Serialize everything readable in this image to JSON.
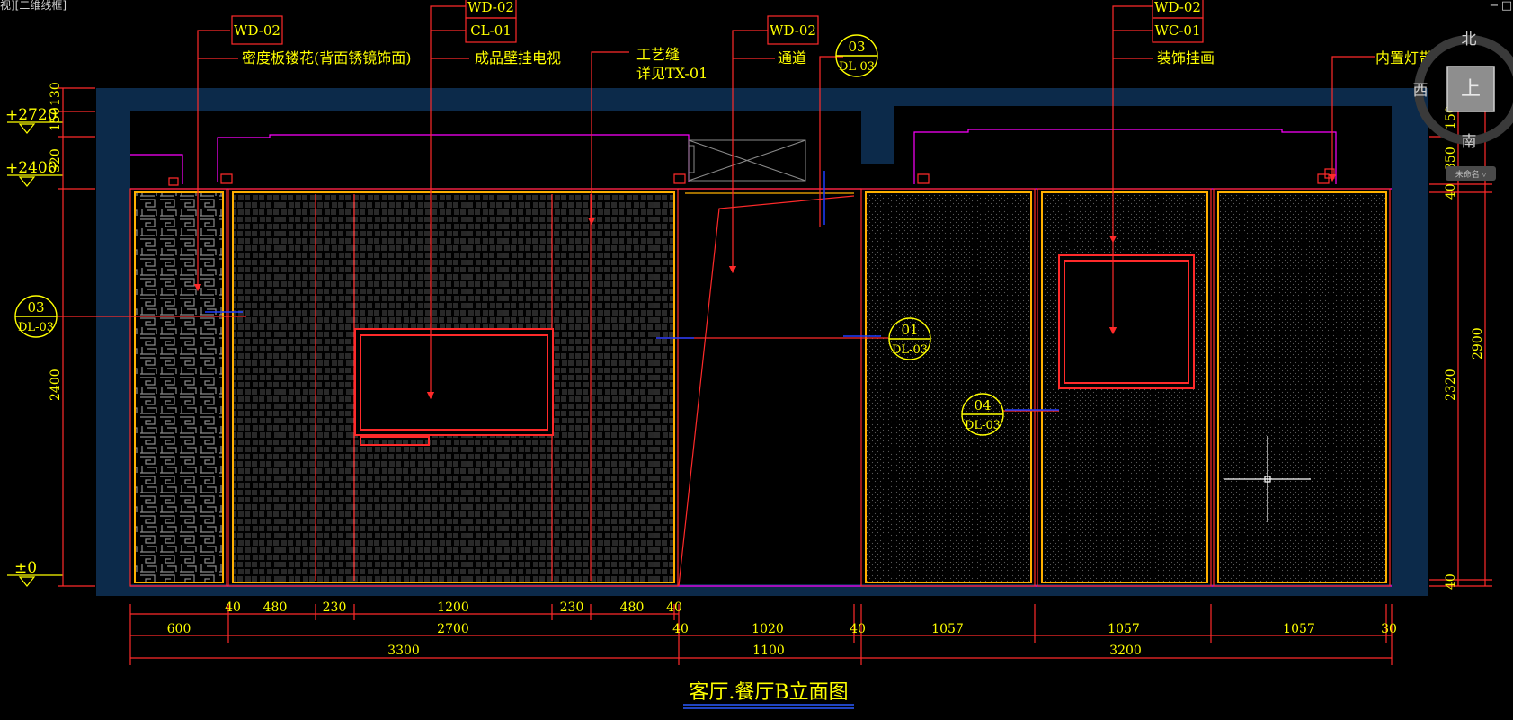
{
  "app": {
    "view_label": "视][二维线框]",
    "window_controls": [
      "−",
      "□"
    ]
  },
  "colors": {
    "background": "#000000",
    "structure": "#0c2a4a",
    "red": "#ff2a2a",
    "yellow": "#ffff00",
    "orange": "#ffb000",
    "magenta": "#ff00ff",
    "white": "#ffffff",
    "cyan": "#00c8c8",
    "blue": "#1e3cff",
    "gray": "#7a7a7a"
  },
  "drawing": {
    "title": "客厅.餐厅B立面图",
    "tags": {
      "t1": "WD-02",
      "t2a": "WD-02",
      "t2b": "CL-01",
      "t3": "WD-02",
      "t4a": "WD-02",
      "t4b": "WC-01"
    },
    "notes": {
      "n1": "密度板镂花(背面锈镜饰面)",
      "n2": "成品壁挂电视",
      "n3a": "工艺缝",
      "n3b": "详见TX-01",
      "n4": "通道",
      "n5": "装饰挂画",
      "n6": "内置灯带"
    },
    "sections": [
      {
        "top": "03",
        "bottom": "DL-03"
      },
      {
        "top": "03",
        "bottom": "DL-03"
      },
      {
        "top": "01",
        "bottom": "DL-03"
      },
      {
        "top": "04",
        "bottom": "DL-03"
      }
    ],
    "levels": {
      "l1": "+2720",
      "l2": "+2400",
      "l3": "±0"
    },
    "left_dims": {
      "d130": "130",
      "d150": "150",
      "d320": "320",
      "d2400": "2400"
    },
    "right_dims": {
      "d150": "150",
      "d350": "350",
      "d40a": "40",
      "d2320": "2320",
      "d2900": "2900",
      "d40b": "40"
    },
    "dim_row1": {
      "a": "40",
      "b": "480",
      "c": "230",
      "d": "1200",
      "e": "230",
      "f": "480",
      "g": "40"
    },
    "dim_row2": {
      "a": "600",
      "b": "2700",
      "c": "40",
      "d": "1020",
      "e": "40",
      "f": "1057",
      "g": "1057",
      "h": "1057",
      "i": "30"
    },
    "dim_row3": {
      "a": "3300",
      "b": "1100",
      "c": "3200"
    },
    "compass": {
      "north": "北",
      "south": "南",
      "west": "西",
      "center": "上",
      "badge": "未命名 ▿"
    }
  }
}
